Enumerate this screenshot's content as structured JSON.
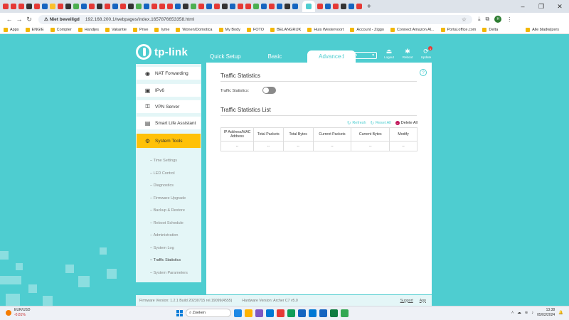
{
  "browser": {
    "url": "192.168.200.1/webpages/index.1657876653358.html",
    "security": "Niet beveiligd",
    "profile_initial": "H",
    "tab_favicons": [
      "#e53935",
      "#e53935",
      "#e53935",
      "#333333",
      "#e53935",
      "#1565c0",
      "#fbc02d",
      "#e53935",
      "#333333",
      "#4caf50",
      "#1565c0",
      "#e53935",
      "#333333",
      "#e53935",
      "#1565c0",
      "#e53935",
      "#333333",
      "#4caf50",
      "#1565c0",
      "#e53935",
      "#e53935",
      "#e53935",
      "#1565c0",
      "#333333",
      "#4caf50",
      "#e53935",
      "#1565c0",
      "#e53935",
      "#333333",
      "#1565c0",
      "#e53935",
      "#e53935",
      "#4caf50",
      "#1565c0",
      "#e53935",
      "#1565c0",
      "#333333",
      "#1565c0",
      "#e53935",
      "#1565c0",
      "#e53935",
      "#333333",
      "#1565c0",
      "#e53935"
    ],
    "bookmarks": [
      "Apps",
      "ENGIE",
      "Compter",
      "Handjes",
      "Vakantie",
      "Prive",
      "Iyme",
      "Wonen/Domotica",
      "My Body",
      "FOTO",
      "BELANGRIJK",
      "Huis Westervoort",
      "Account - Ziggo",
      "Connect Amazon Al...",
      "Portal.office.com",
      "Delta"
    ],
    "all_bookmarks": "Alle bladwijzers"
  },
  "router": {
    "logo": "tp-link",
    "tabs": [
      "Quick Setup",
      "Basic",
      "Advanced"
    ],
    "language": "English",
    "top_icons": [
      {
        "label": "Logout",
        "icon": "logout-icon",
        "glyph": "⏏"
      },
      {
        "label": "Reboot",
        "icon": "reboot-icon",
        "glyph": "✱"
      },
      {
        "label": "Update",
        "icon": "update-icon",
        "glyph": "⟳",
        "badge": "1"
      }
    ],
    "sidebar": [
      {
        "label": "NAT Forwarding",
        "glyph": "◉"
      },
      {
        "label": "IPv6",
        "glyph": "▣"
      },
      {
        "label": "VPN Server",
        "glyph": "⚿"
      },
      {
        "label": "Smart Life Assistant",
        "glyph": "▤"
      },
      {
        "label": "System Tools",
        "glyph": "⚙"
      }
    ],
    "subitems": [
      "Time Settings",
      "LED Control",
      "Diagnostics",
      "Firmware Upgrade",
      "Backup & Restore",
      "Reboot Schedule",
      "Administration",
      "System Log",
      "Traffic Statistics",
      "System Parameters"
    ],
    "traffic": {
      "title": "Traffic Statistics",
      "toggle_label": "Traffic Statistics:",
      "list_title": "Traffic Statistics List",
      "actions": [
        "Refresh",
        "Reset All",
        "Delete All"
      ],
      "columns": [
        "IP Address/MAC Address",
        "Total Packets",
        "Total Bytes",
        "Current Packets",
        "Current Bytes",
        "Modify"
      ],
      "rows": [
        [
          "--",
          "--",
          "--",
          "--",
          "--",
          "--"
        ]
      ]
    },
    "footer": {
      "firmware": "Firmware Version: 1.2.1 Build 20230715 rel.19099(4555)",
      "hardware": "Hardware Version: Archer C7 v5.0",
      "support": "Support",
      "app": "App"
    }
  },
  "taskbar": {
    "ticker": "EUR/USD",
    "change": "-0.81%",
    "search": "Zoeken",
    "time": "13:38",
    "date": "05/02/2024",
    "app_colors": [
      "#1e88e5",
      "#ffb300",
      "#7e57c2",
      "#0078d4",
      "#e53935",
      "#0f9d58",
      "#1565c0",
      "#0078d4",
      "#1565c0",
      "#107c41",
      "#34a853"
    ]
  }
}
